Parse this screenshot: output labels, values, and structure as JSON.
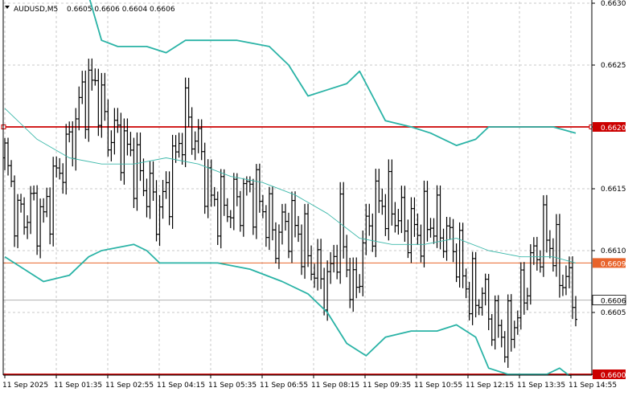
{
  "header": {
    "symbol_timeframe": "AUDUSD,M5",
    "quotes": "0.6605 0.6606 0.6604 0.6606",
    "menu_icon": "triangle-down-icon"
  },
  "price_scale": {
    "ticks": [
      "0.6630",
      "0.6625",
      "0.6620",
      "0.6615",
      "0.6610",
      "0.6605",
      "0.6600"
    ]
  },
  "time_scale": {
    "ticks": [
      "11 Sep 2025",
      "11 Sep 01:35",
      "11 Sep 02:55",
      "11 Sep 04:15",
      "11 Sep 05:35",
      "11 Sep 06:55",
      "11 Sep 08:15",
      "11 Sep 09:35",
      "11 Sep 10:55",
      "11 Sep 12:15",
      "11 Sep 13:35",
      "11 Sep 14:55"
    ]
  },
  "level_lines": [
    {
      "price": 0.662,
      "label": "0.6620",
      "color": "#cc0000"
    },
    {
      "price": 0.6609,
      "label": "0.6609",
      "color": "#e8642c"
    },
    {
      "price": 0.66,
      "label": "0.6600",
      "color": "#cc0000"
    }
  ],
  "current_price": {
    "price": 0.6606,
    "label": "0.6606"
  },
  "colors": {
    "bollinger_band": "#2ab3a6",
    "moving_average": "#3cb8aa",
    "grid": "#c8c8c8",
    "bar": "#000000"
  },
  "chart_data": {
    "type": "ohlc",
    "symbol": "AUDUSD",
    "timeframe": "M5",
    "y_range": [
      0.6599,
      0.6631
    ],
    "bar_count": 178,
    "close_path": [
      [
        0,
        0.66175
      ],
      [
        4,
        0.66125
      ],
      [
        8,
        0.66135
      ],
      [
        12,
        0.66125
      ],
      [
        16,
        0.6616
      ],
      [
        20,
        0.66185
      ],
      [
        24,
        0.66225
      ],
      [
        28,
        0.66235
      ],
      [
        32,
        0.66195
      ],
      [
        36,
        0.6619
      ],
      [
        40,
        0.6617
      ],
      [
        44,
        0.6615
      ],
      [
        48,
        0.6613
      ],
      [
        52,
        0.66165
      ],
      [
        56,
        0.6621
      ],
      [
        60,
        0.66185
      ],
      [
        64,
        0.6614
      ],
      [
        68,
        0.66135
      ],
      [
        72,
        0.6614
      ],
      [
        76,
        0.6615
      ],
      [
        80,
        0.66135
      ],
      [
        84,
        0.6611
      ],
      [
        88,
        0.66125
      ],
      [
        92,
        0.6611
      ],
      [
        96,
        0.66085
      ],
      [
        100,
        0.6607
      ],
      [
        104,
        0.6612
      ],
      [
        108,
        0.6606
      ],
      [
        112,
        0.66115
      ],
      [
        116,
        0.6614
      ],
      [
        120,
        0.66135
      ],
      [
        124,
        0.6612
      ],
      [
        128,
        0.66115
      ],
      [
        132,
        0.66125
      ],
      [
        136,
        0.66115
      ],
      [
        140,
        0.661
      ],
      [
        144,
        0.66065
      ],
      [
        148,
        0.66065
      ],
      [
        152,
        0.6604
      ],
      [
        156,
        0.6603
      ],
      [
        160,
        0.6606
      ],
      [
        164,
        0.66095
      ],
      [
        168,
        0.66115
      ],
      [
        172,
        0.66085
      ],
      [
        177,
        0.6606
      ]
    ],
    "middle_band": [
      [
        0,
        0.66215
      ],
      [
        10,
        0.6619
      ],
      [
        20,
        0.66175
      ],
      [
        30,
        0.6617
      ],
      [
        40,
        0.6617
      ],
      [
        50,
        0.66175
      ],
      [
        60,
        0.6617
      ],
      [
        70,
        0.6616
      ],
      [
        80,
        0.66155
      ],
      [
        90,
        0.66145
      ],
      [
        100,
        0.6613
      ],
      [
        110,
        0.6611
      ],
      [
        120,
        0.66105
      ],
      [
        130,
        0.66105
      ],
      [
        140,
        0.6611
      ],
      [
        150,
        0.661
      ],
      [
        160,
        0.66095
      ],
      [
        170,
        0.66095
      ],
      [
        177,
        0.6609
      ]
    ],
    "upper_band": [
      [
        0,
        0.6633
      ],
      [
        10,
        0.6633
      ],
      [
        20,
        0.6633
      ],
      [
        25,
        0.66315
      ],
      [
        30,
        0.6627
      ],
      [
        35,
        0.66265
      ],
      [
        44,
        0.66265
      ],
      [
        50,
        0.6626
      ],
      [
        56,
        0.6627
      ],
      [
        64,
        0.6627
      ],
      [
        72,
        0.6627
      ],
      [
        82,
        0.66265
      ],
      [
        88,
        0.6625
      ],
      [
        94,
        0.66225
      ],
      [
        100,
        0.6623
      ],
      [
        106,
        0.66235
      ],
      [
        110,
        0.66245
      ],
      [
        114,
        0.66225
      ],
      [
        118,
        0.66205
      ],
      [
        126,
        0.662
      ],
      [
        132,
        0.66195
      ],
      [
        140,
        0.66185
      ],
      [
        146,
        0.6619
      ],
      [
        150,
        0.662
      ],
      [
        160,
        0.662
      ],
      [
        170,
        0.662
      ],
      [
        177,
        0.66195
      ]
    ],
    "lower_band": [
      [
        0,
        0.66095
      ],
      [
        6,
        0.66085
      ],
      [
        12,
        0.66075
      ],
      [
        20,
        0.6608
      ],
      [
        26,
        0.66095
      ],
      [
        30,
        0.661
      ],
      [
        40,
        0.66105
      ],
      [
        44,
        0.661
      ],
      [
        48,
        0.6609
      ],
      [
        56,
        0.6609
      ],
      [
        66,
        0.6609
      ],
      [
        76,
        0.66085
      ],
      [
        86,
        0.66075
      ],
      [
        94,
        0.66065
      ],
      [
        100,
        0.6605
      ],
      [
        106,
        0.66025
      ],
      [
        112,
        0.66015
      ],
      [
        118,
        0.6603
      ],
      [
        126,
        0.66035
      ],
      [
        134,
        0.66035
      ],
      [
        140,
        0.6604
      ],
      [
        146,
        0.6603
      ],
      [
        150,
        0.66005
      ],
      [
        156,
        0.66
      ],
      [
        162,
        0.66
      ],
      [
        168,
        0.66
      ],
      [
        172,
        0.66005
      ],
      [
        177,
        0.65995
      ]
    ],
    "grid": true
  }
}
